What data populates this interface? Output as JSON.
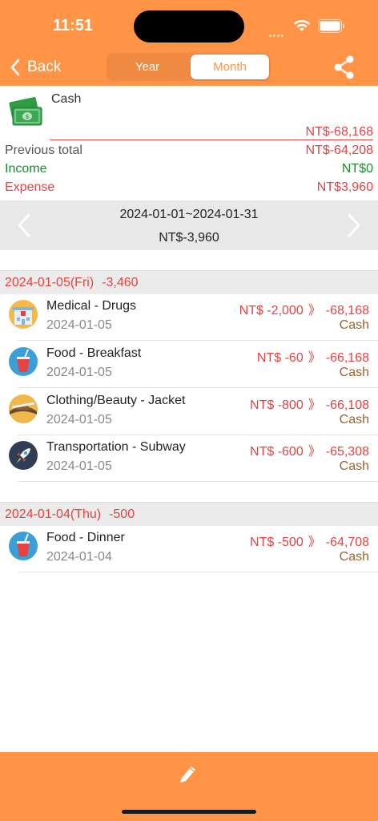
{
  "status": {
    "time": "11:51"
  },
  "nav": {
    "back_label": "Back",
    "segments": [
      "Year",
      "Month"
    ],
    "selected_segment": "Month",
    "share_icon": "share-icon"
  },
  "account": {
    "name": "Cash",
    "icon": "cash-icon",
    "balance": "NT$-68,168",
    "previous_total_label": "Previous total",
    "previous_total_value": "NT$-64,208",
    "income_label": "Income",
    "income_value": "NT$0",
    "expense_label": "Expense",
    "expense_value": "NT$3,960"
  },
  "period": {
    "range": "2024-01-01~2024-01-31",
    "total": "NT$-3,960"
  },
  "days": [
    {
      "date": "2024-01-05(Fri)",
      "total": "-3,460",
      "transactions": [
        {
          "title": "Medical - Drugs",
          "date": "2024-01-05",
          "amount": "NT$ -2,000",
          "running": "-68,168",
          "account": "Cash",
          "icon": "hospital-icon"
        },
        {
          "title": "Food - Breakfast",
          "date": "2024-01-05",
          "amount": "NT$ -60",
          "running": "-66,168",
          "account": "Cash",
          "icon": "drink-icon"
        },
        {
          "title": "Clothing/Beauty - Jacket",
          "date": "2024-01-05",
          "amount": "NT$ -800",
          "running": "-66,108",
          "account": "Cash",
          "icon": "hat-icon"
        },
        {
          "title": "Transportation - Subway",
          "date": "2024-01-05",
          "amount": "NT$ -600",
          "running": "-65,308",
          "account": "Cash",
          "icon": "rocket-icon"
        }
      ]
    },
    {
      "date": "2024-01-04(Thu)",
      "total": "-500",
      "transactions": [
        {
          "title": "Food - Dinner",
          "date": "2024-01-04",
          "amount": "NT$ -500",
          "running": "-64,708",
          "account": "Cash",
          "icon": "drink-icon"
        }
      ]
    }
  ],
  "separator": "》",
  "colors": {
    "brand": "#ff9447",
    "expense": "#e8413f",
    "income": "#1a8a2e",
    "account": "#a0622b"
  }
}
